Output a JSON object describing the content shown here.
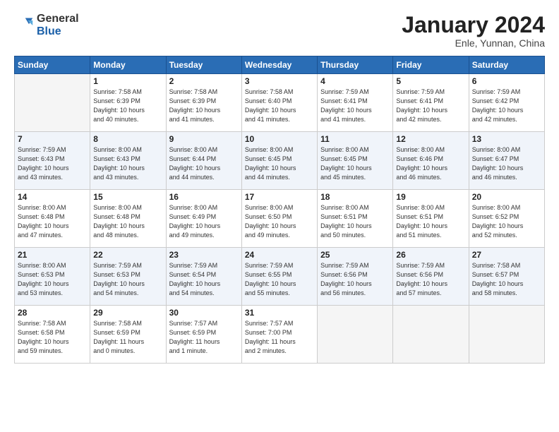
{
  "header": {
    "logo_general": "General",
    "logo_blue": "Blue",
    "month_title": "January 2024",
    "subtitle": "Enle, Yunnan, China"
  },
  "weekdays": [
    "Sunday",
    "Monday",
    "Tuesday",
    "Wednesday",
    "Thursday",
    "Friday",
    "Saturday"
  ],
  "weeks": [
    [
      {
        "day": "",
        "empty": true
      },
      {
        "day": "1",
        "sunrise": "7:58 AM",
        "sunset": "6:39 PM",
        "daylight": "10 hours and 40 minutes."
      },
      {
        "day": "2",
        "sunrise": "7:58 AM",
        "sunset": "6:39 PM",
        "daylight": "10 hours and 41 minutes."
      },
      {
        "day": "3",
        "sunrise": "7:58 AM",
        "sunset": "6:40 PM",
        "daylight": "10 hours and 41 minutes."
      },
      {
        "day": "4",
        "sunrise": "7:59 AM",
        "sunset": "6:41 PM",
        "daylight": "10 hours and 41 minutes."
      },
      {
        "day": "5",
        "sunrise": "7:59 AM",
        "sunset": "6:41 PM",
        "daylight": "10 hours and 42 minutes."
      },
      {
        "day": "6",
        "sunrise": "7:59 AM",
        "sunset": "6:42 PM",
        "daylight": "10 hours and 42 minutes."
      }
    ],
    [
      {
        "day": "7",
        "sunrise": "7:59 AM",
        "sunset": "6:43 PM",
        "daylight": "10 hours and 43 minutes."
      },
      {
        "day": "8",
        "sunrise": "8:00 AM",
        "sunset": "6:43 PM",
        "daylight": "10 hours and 43 minutes."
      },
      {
        "day": "9",
        "sunrise": "8:00 AM",
        "sunset": "6:44 PM",
        "daylight": "10 hours and 44 minutes."
      },
      {
        "day": "10",
        "sunrise": "8:00 AM",
        "sunset": "6:45 PM",
        "daylight": "10 hours and 44 minutes."
      },
      {
        "day": "11",
        "sunrise": "8:00 AM",
        "sunset": "6:45 PM",
        "daylight": "10 hours and 45 minutes."
      },
      {
        "day": "12",
        "sunrise": "8:00 AM",
        "sunset": "6:46 PM",
        "daylight": "10 hours and 46 minutes."
      },
      {
        "day": "13",
        "sunrise": "8:00 AM",
        "sunset": "6:47 PM",
        "daylight": "10 hours and 46 minutes."
      }
    ],
    [
      {
        "day": "14",
        "sunrise": "8:00 AM",
        "sunset": "6:48 PM",
        "daylight": "10 hours and 47 minutes."
      },
      {
        "day": "15",
        "sunrise": "8:00 AM",
        "sunset": "6:48 PM",
        "daylight": "10 hours and 48 minutes."
      },
      {
        "day": "16",
        "sunrise": "8:00 AM",
        "sunset": "6:49 PM",
        "daylight": "10 hours and 49 minutes."
      },
      {
        "day": "17",
        "sunrise": "8:00 AM",
        "sunset": "6:50 PM",
        "daylight": "10 hours and 49 minutes."
      },
      {
        "day": "18",
        "sunrise": "8:00 AM",
        "sunset": "6:51 PM",
        "daylight": "10 hours and 50 minutes."
      },
      {
        "day": "19",
        "sunrise": "8:00 AM",
        "sunset": "6:51 PM",
        "daylight": "10 hours and 51 minutes."
      },
      {
        "day": "20",
        "sunrise": "8:00 AM",
        "sunset": "6:52 PM",
        "daylight": "10 hours and 52 minutes."
      }
    ],
    [
      {
        "day": "21",
        "sunrise": "8:00 AM",
        "sunset": "6:53 PM",
        "daylight": "10 hours and 53 minutes."
      },
      {
        "day": "22",
        "sunrise": "7:59 AM",
        "sunset": "6:53 PM",
        "daylight": "10 hours and 54 minutes."
      },
      {
        "day": "23",
        "sunrise": "7:59 AM",
        "sunset": "6:54 PM",
        "daylight": "10 hours and 54 minutes."
      },
      {
        "day": "24",
        "sunrise": "7:59 AM",
        "sunset": "6:55 PM",
        "daylight": "10 hours and 55 minutes."
      },
      {
        "day": "25",
        "sunrise": "7:59 AM",
        "sunset": "6:56 PM",
        "daylight": "10 hours and 56 minutes."
      },
      {
        "day": "26",
        "sunrise": "7:59 AM",
        "sunset": "6:56 PM",
        "daylight": "10 hours and 57 minutes."
      },
      {
        "day": "27",
        "sunrise": "7:58 AM",
        "sunset": "6:57 PM",
        "daylight": "10 hours and 58 minutes."
      }
    ],
    [
      {
        "day": "28",
        "sunrise": "7:58 AM",
        "sunset": "6:58 PM",
        "daylight": "10 hours and 59 minutes."
      },
      {
        "day": "29",
        "sunrise": "7:58 AM",
        "sunset": "6:59 PM",
        "daylight": "11 hours and 0 minutes."
      },
      {
        "day": "30",
        "sunrise": "7:57 AM",
        "sunset": "6:59 PM",
        "daylight": "11 hours and 1 minute."
      },
      {
        "day": "31",
        "sunrise": "7:57 AM",
        "sunset": "7:00 PM",
        "daylight": "11 hours and 2 minutes."
      },
      {
        "day": "",
        "empty": true
      },
      {
        "day": "",
        "empty": true
      },
      {
        "day": "",
        "empty": true
      }
    ]
  ],
  "labels": {
    "sunrise": "Sunrise:",
    "sunset": "Sunset:",
    "daylight": "Daylight:"
  }
}
